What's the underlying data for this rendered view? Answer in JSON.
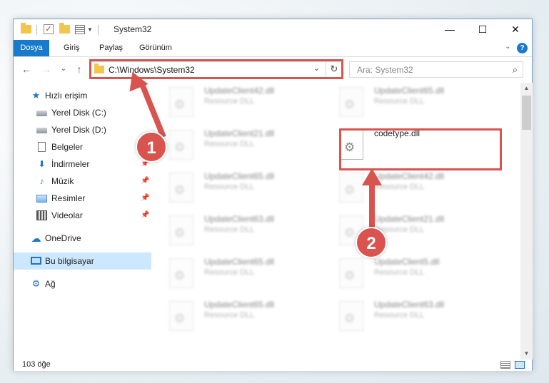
{
  "window": {
    "title": "System32"
  },
  "window_controls": {
    "minimize": "—",
    "maximize": "☐",
    "close": "✕"
  },
  "ribbon": {
    "tabs": [
      "Dosya",
      "Giriş",
      "Paylaş",
      "Görünüm"
    ],
    "collapse": "⌄",
    "help": "?"
  },
  "navigation": {
    "back": "←",
    "forward": "→",
    "recent": "⌄",
    "up": "↑",
    "address": "C:\\Windows\\System32",
    "address_dropdown": "⌄",
    "refresh": "↻",
    "search_placeholder": "Ara: System32",
    "search_icon": "⌕"
  },
  "sidebar": {
    "items": [
      {
        "label": "Hızlı erişim",
        "icon": "star-icon",
        "glyph": "★",
        "pinned": false
      },
      {
        "label": "Yerel Disk (C:)",
        "icon": "disk-icon",
        "glyph": "",
        "pinned": false
      },
      {
        "label": "Yerel Disk (D:)",
        "icon": "disk-icon",
        "glyph": "",
        "pinned": false
      },
      {
        "label": "Belgeler",
        "icon": "document-icon",
        "glyph": "",
        "pinned": false
      },
      {
        "label": "İndirmeler",
        "icon": "download-icon",
        "glyph": "⬇",
        "pinned": true
      },
      {
        "label": "Müzik",
        "icon": "music-icon",
        "glyph": "♪",
        "pinned": true
      },
      {
        "label": "Resimler",
        "icon": "pictures-icon",
        "glyph": "",
        "pinned": true
      },
      {
        "label": "Videolar",
        "icon": "videos-icon",
        "glyph": "",
        "pinned": true
      },
      {
        "label": "OneDrive",
        "icon": "cloud-icon",
        "glyph": "☁",
        "pinned": false
      },
      {
        "label": "Bu bilgisayar",
        "icon": "computer-icon",
        "glyph": "",
        "pinned": false,
        "selected": true
      },
      {
        "label": "Ağ",
        "icon": "network-icon",
        "glyph": "⚙",
        "pinned": false
      }
    ],
    "pin_glyph": "📌"
  },
  "files": [
    {
      "name": "UpdateClient42.dll",
      "type": "Resource DLL"
    },
    {
      "name": "UpdateClient65.dll",
      "type": "Resource DLL"
    },
    {
      "name": "UpdateClient21.dll",
      "type": "Resource DLL"
    },
    {
      "name": "codetype.dll",
      "type": "",
      "highlighted": true
    },
    {
      "name": "UpdateClient65.dll",
      "type": "Resource DLL"
    },
    {
      "name": "UpdateClient42.dll",
      "type": "Resource DLL"
    },
    {
      "name": "UpdateClient63.dll",
      "type": "Resource DLL"
    },
    {
      "name": "UpdateClient21.dll",
      "type": "Resource DLL"
    },
    {
      "name": "UpdateClient65.dll",
      "type": "Resource DLL"
    },
    {
      "name": "UpdateClient5.dll",
      "type": "Resource DLL"
    },
    {
      "name": "UpdateClient65.dll",
      "type": "Resource DLL"
    },
    {
      "name": "UpdateClient63.dll",
      "type": "Resource DLL"
    }
  ],
  "status": {
    "item_count": "103 öğe"
  },
  "scrollbar": {
    "up": "▲",
    "down": "▼"
  },
  "annotations": {
    "step1": "1",
    "step2": "2",
    "color": "#d9534f"
  }
}
